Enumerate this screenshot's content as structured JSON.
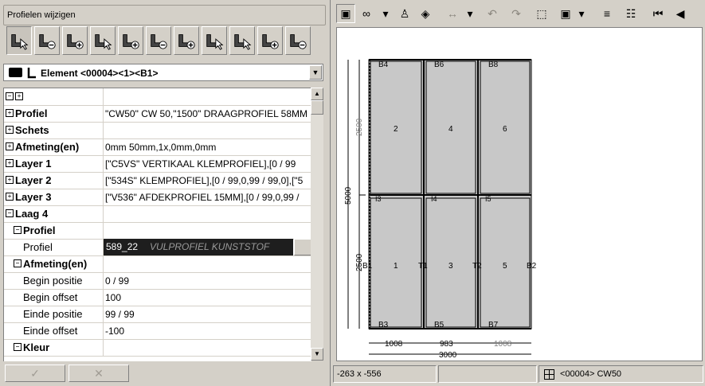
{
  "dialog": {
    "title": "Profielen wijzigen",
    "toolbar_icons": [
      "profile-select-icon",
      "profile-remove-icon",
      "profile-add-icon",
      "profile-select-icon",
      "profile-add-icon",
      "profile-remove-icon",
      "profile-add-icon",
      "profile-select-icon",
      "profile-select-icon",
      "profile-add-icon",
      "profile-remove-icon"
    ],
    "element_selector": "Element <00004><1><B1>",
    "ok_label": "✓",
    "cancel_label": "✕"
  },
  "grid": {
    "header_toggle": "⊟⊞",
    "rows": [
      {
        "sign": "+",
        "label": "Profiel",
        "bold": true,
        "indent": 0,
        "value": "\"CW50\" CW 50,\"1500\" DRAAGPROFIEL 58MM"
      },
      {
        "sign": "+",
        "label": "Schets",
        "bold": true,
        "indent": 0,
        "value": ""
      },
      {
        "sign": "+",
        "label": "Afmeting(en)",
        "bold": true,
        "indent": 0,
        "value": "0mm 50mm,1x,0mm,0mm"
      },
      {
        "sign": "+",
        "label": "Layer 1",
        "bold": true,
        "indent": 0,
        "value": "[\"C5VS\" VERTIKAAL KLEMPROFIEL],[0 / 99"
      },
      {
        "sign": "+",
        "label": "Layer 2",
        "bold": true,
        "indent": 0,
        "value": "[\"534S\" KLEMPROFIEL],[0 / 99,0,99 / 99,0],[\"5"
      },
      {
        "sign": "+",
        "label": "Layer 3",
        "bold": true,
        "indent": 0,
        "value": "[\"V536\" AFDEKPROFIEL 15MM],[0 / 99,0,99 /"
      },
      {
        "sign": "-",
        "label": "Laag 4",
        "bold": true,
        "indent": 0,
        "value": ""
      },
      {
        "sign": "-",
        "label": "Profiel",
        "bold": true,
        "indent": 1,
        "value": ""
      },
      {
        "sign": "",
        "label": "Profiel",
        "bold": false,
        "indent": 2,
        "value": "589_22",
        "extra": "VULPROFIEL KUNSTSTOF",
        "selected": true
      },
      {
        "sign": "-",
        "label": "Afmeting(en)",
        "bold": true,
        "indent": 1,
        "value": ""
      },
      {
        "sign": "",
        "label": "Begin positie",
        "bold": false,
        "indent": 2,
        "value": "0 / 99"
      },
      {
        "sign": "",
        "label": "Begin offset",
        "bold": false,
        "indent": 2,
        "value": "100"
      },
      {
        "sign": "",
        "label": "Einde positie",
        "bold": false,
        "indent": 2,
        "value": "99 / 99"
      },
      {
        "sign": "",
        "label": "Einde offset",
        "bold": false,
        "indent": 2,
        "value": "-100"
      },
      {
        "sign": "-",
        "label": "Kleur",
        "bold": true,
        "indent": 1,
        "value": ""
      }
    ]
  },
  "drawing": {
    "panels_top": [
      {
        "num": "2",
        "b": "B4"
      },
      {
        "num": "4",
        "b": "B6"
      },
      {
        "num": "6",
        "b": "B8"
      }
    ],
    "panels_bottom": [
      {
        "num": "1",
        "b": "B3"
      },
      {
        "num": "3",
        "b": "B5"
      },
      {
        "num": "5",
        "b": "B7"
      }
    ],
    "mid_labels": [
      "B1",
      "T1",
      "T2",
      "B2"
    ],
    "marks": [
      "I3",
      "I4",
      "I5"
    ],
    "dim_left_total": "5000",
    "dim_left_top": "2500",
    "dim_left_bottom": "2500",
    "dim_bottom": [
      "1008",
      "983",
      "1008"
    ],
    "dim_total": "3000"
  },
  "status": {
    "coords": "-263 x -556",
    "mid": "",
    "element": "<00004> CW50"
  },
  "viewer_toolbar": [
    "frame-icon",
    "glasses-icon",
    "dropdown-icon",
    "person-icon",
    "layers-icon",
    "dimension-icon",
    "dropdown-icon",
    "undo-icon",
    "redo-icon",
    "zoom-window-icon",
    "zoom-fit-icon",
    "dropdown-icon",
    "align-icon",
    "properties-icon",
    "first-icon",
    "previous-icon"
  ]
}
